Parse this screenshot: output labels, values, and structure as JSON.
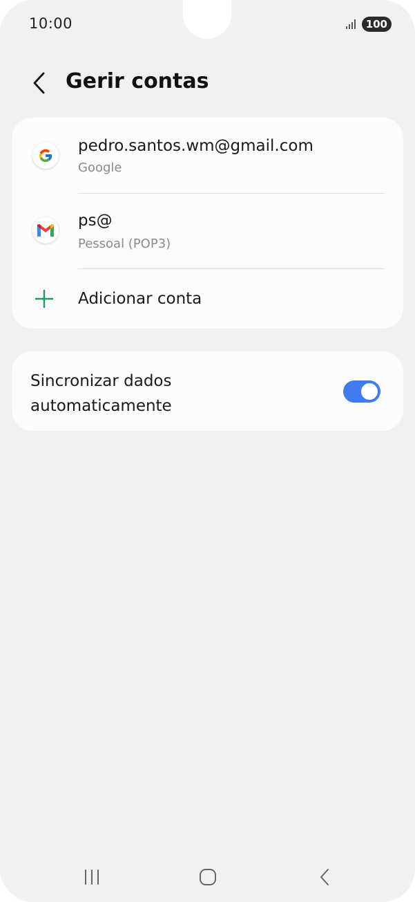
{
  "status_bar": {
    "time": "10:00",
    "battery": "100"
  },
  "header": {
    "title": "Gerir contas"
  },
  "accounts": [
    {
      "icon": "google-icon",
      "primary": "pedro.santos.wm@gmail.com",
      "secondary": "Google"
    },
    {
      "icon": "gmail-icon",
      "primary": "ps@",
      "secondary": "Pessoal (POP3)"
    }
  ],
  "add_account": {
    "label": "Adicionar conta"
  },
  "sync": {
    "label": "Sincronizar dados automaticamente",
    "enabled": true
  },
  "colors": {
    "toggle_on": "#3e7cf0",
    "plus": "#1f9d57"
  }
}
